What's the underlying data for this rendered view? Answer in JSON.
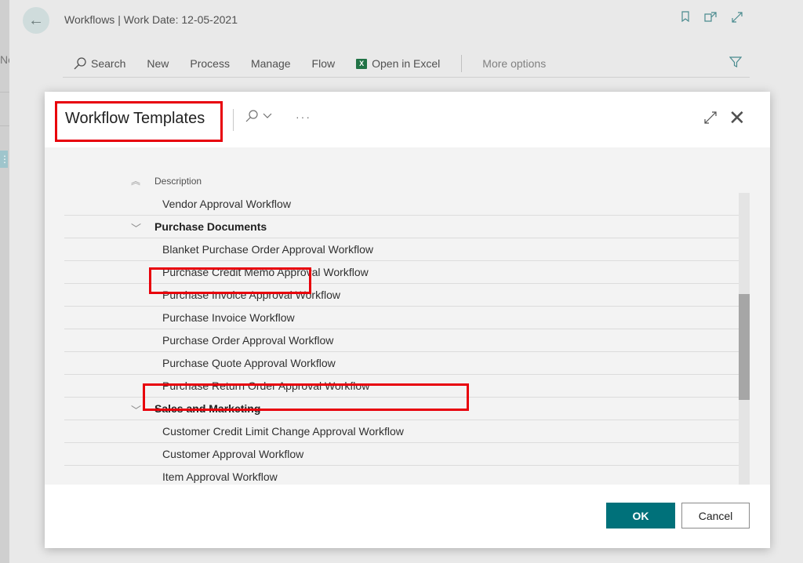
{
  "background": {
    "left_text": "Ne",
    "page_title": "Workflows | Work Date: 12-05-2021",
    "toolbar": {
      "search": "Search",
      "new": "New",
      "process": "Process",
      "manage": "Manage",
      "flow": "Flow",
      "open_in_excel": "Open in Excel",
      "more_options": "More options"
    }
  },
  "dialog": {
    "title": "Workflow Templates",
    "column_header": "Description",
    "rows": [
      {
        "type": "item",
        "label": "Vendor Approval Workflow"
      },
      {
        "type": "group",
        "label": "Purchase Documents"
      },
      {
        "type": "item",
        "label": "Blanket Purchase Order Approval Workflow"
      },
      {
        "type": "item",
        "label": "Purchase Credit Memo Approval Workflow"
      },
      {
        "type": "item",
        "label": "Purchase Invoice Approval Workflow"
      },
      {
        "type": "item",
        "label": "Purchase Invoice Workflow"
      },
      {
        "type": "item",
        "label": "Purchase Order Approval Workflow"
      },
      {
        "type": "item",
        "label": "Purchase Quote Approval Workflow"
      },
      {
        "type": "item",
        "label": "Purchase Return Order Approval Workflow"
      },
      {
        "type": "group",
        "label": "Sales and Marketing"
      },
      {
        "type": "item",
        "label": "Customer Credit Limit Change Approval Workflow"
      },
      {
        "type": "item",
        "label": "Customer Approval Workflow"
      },
      {
        "type": "item",
        "label": "Item Approval Workflow"
      }
    ],
    "ok_label": "OK",
    "cancel_label": "Cancel"
  },
  "colors": {
    "accent": "#00717a",
    "highlight_box": "#e8000b"
  }
}
